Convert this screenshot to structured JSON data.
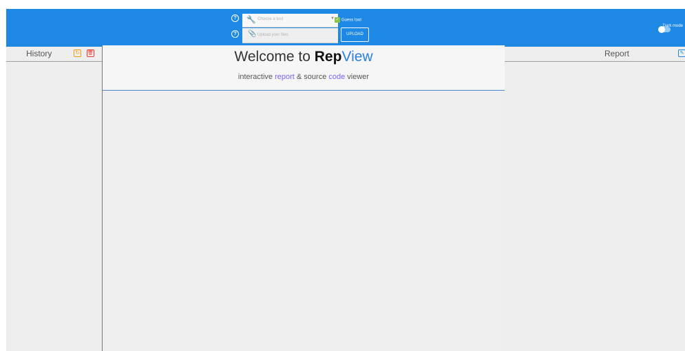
{
  "header": {
    "tool_select": {
      "placeholder": "Choose a tool",
      "icon": "wrench-icon"
    },
    "guess_tool": {
      "label": "Guess tool",
      "checked": true
    },
    "upload_field": {
      "placeholder": "Upload your files",
      "icon": "paperclip-icon"
    },
    "upload_button": "UPLOAD",
    "dark_mode": {
      "label": "Dark mode",
      "enabled": false
    },
    "help_glyph": "?"
  },
  "history": {
    "title": "History",
    "refresh_icon": "↻",
    "delete_icon": "🗑"
  },
  "welcome": {
    "title_prefix": "Welcome to ",
    "title_bold": "Rep",
    "title_accent": "View",
    "sub_1": "interactive ",
    "sub_report": "report",
    "sub_2": " & source ",
    "sub_code": "code",
    "sub_3": " viewer"
  },
  "report": {
    "title": "Report",
    "edit_icon": "✎"
  },
  "colors": {
    "topbar": "#1e88e5",
    "accent_blue": "#2a7de1",
    "accent_purple": "#7b61ff",
    "refresh": "#ff9800",
    "delete": "#e53935"
  }
}
